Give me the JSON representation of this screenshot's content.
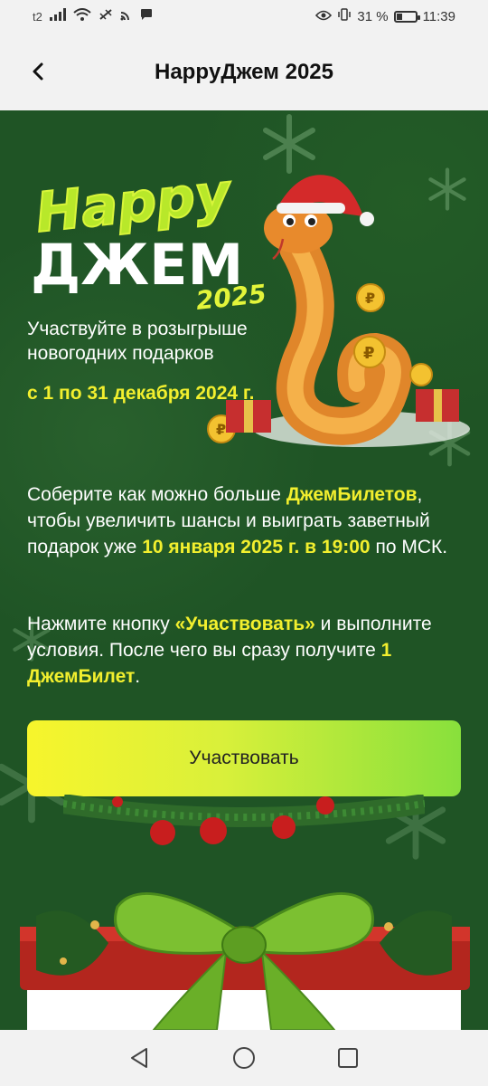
{
  "status_bar": {
    "carrier": "t2",
    "battery_text": "31 %",
    "battery_level": 0.31,
    "time": "11:39"
  },
  "app_bar": {
    "title": "HappyДжем 2025",
    "back_icon": "chevron-left-icon"
  },
  "banner": {
    "logo_happy": "Happy",
    "logo_jam": "ДЖЕМ",
    "logo_year": "2025",
    "intro": "Участвуйте в розыгрыше новогодних подарков",
    "dates": "с 1 по 31 декабря 2024 г."
  },
  "description": {
    "p1_a": "Соберите как можно больше ",
    "p1_b": "ДжемБилетов",
    "p1_c": ", чтобы увеличить шансы и выиграть заветный подарок уже ",
    "p1_d": "10 января 2025 г. в 19:00",
    "p1_e": " по МСК.",
    "p2_a": "Нажмите кнопку ",
    "p2_b": "«Участвовать»",
    "p2_c": " и выполните условия. После чего вы сразу получите ",
    "p2_d": "1 ДжемБилет",
    "p2_e": "."
  },
  "cta": {
    "label": "Участвовать"
  },
  "colors": {
    "background": "#1f5425",
    "highlight": "#f2ef2e",
    "button_start": "#f7f52c",
    "button_end": "#88e03c"
  },
  "nav_bar": {
    "back": "triangle-back-icon",
    "home": "circle-home-icon",
    "recents": "square-recents-icon"
  }
}
